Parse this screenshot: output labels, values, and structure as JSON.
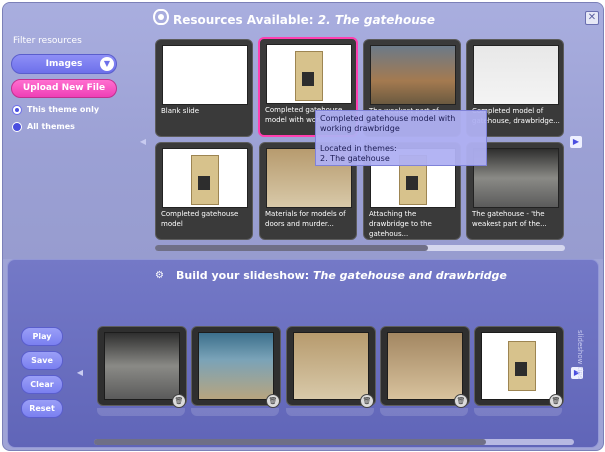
{
  "header": {
    "prefix": "Resources Available:",
    "title": "2. The gatehouse"
  },
  "filter": {
    "label": "Filter resources",
    "type_select": "Images",
    "upload_label": "Upload New File",
    "options": [
      {
        "label": "This theme only",
        "selected": true
      },
      {
        "label": "All themes",
        "selected": false
      }
    ]
  },
  "resources": [
    {
      "caption": "Blank slide"
    },
    {
      "caption": "Completed gatehouse model with working..."
    },
    {
      "caption": "The weakest part of the..."
    },
    {
      "caption": "Completed model of gatehouse, drawbridge..."
    },
    {
      "caption": "Completed gatehouse model"
    },
    {
      "caption": "Materials for models of doors and murder..."
    },
    {
      "caption": "Attaching the drawbridge to the gatehous..."
    },
    {
      "caption": "The gatehouse - 'the weakest part of the..."
    }
  ],
  "tooltip": {
    "title": "Completed gatehouse model with working drawbridge",
    "located_label": "Located in themes:",
    "theme": "2. The gatehouse"
  },
  "builder": {
    "prefix": "Build your slideshow:",
    "title": "The gatehouse and drawbridge",
    "buttons": [
      "Play",
      "Save",
      "Clear",
      "Reset"
    ],
    "side_label": "slideshow tips",
    "slides": 5
  },
  "colors": {
    "accent": "#6d70ea",
    "upload": "#ef3fb6",
    "selection": "#ff3fb0",
    "panel": "#6065b8"
  }
}
